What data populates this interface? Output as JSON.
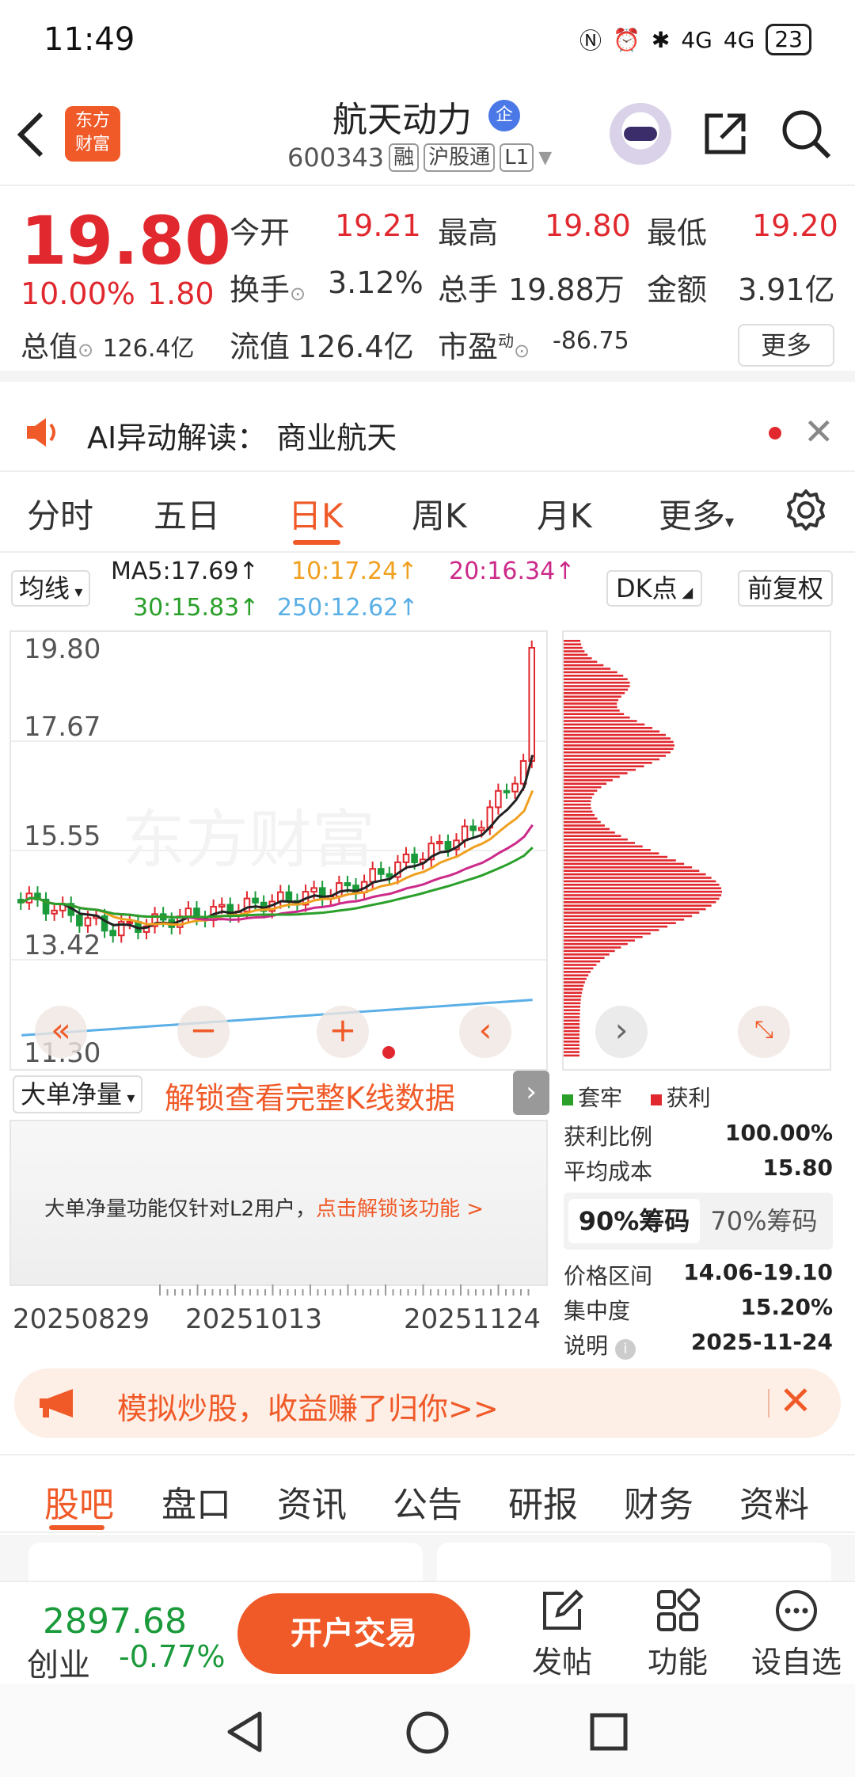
{
  "status": {
    "time": "11:49",
    "battery": "23",
    "net1": "4G",
    "net2": "4G"
  },
  "header": {
    "stock_name": "航天动力",
    "badge": "企",
    "code": "600343",
    "tags": [
      "融",
      "沪股通",
      "L1"
    ],
    "logo_line1": "东方",
    "logo_line2": "财富"
  },
  "quote": {
    "price": "19.80",
    "pct": "10.00%",
    "change": "1.80",
    "total_value_label": "总值",
    "total_value": "126.4亿",
    "open_label": "今开",
    "open": "19.21",
    "high_label": "最高",
    "high": "19.80",
    "low_label": "最低",
    "low": "19.20",
    "turnover_label": "换手",
    "turnover": "3.12%",
    "volume_label": "总手",
    "volume": "19.88万",
    "amount_label": "金额",
    "amount": "3.91亿",
    "float_label": "流值",
    "float": "126.4亿",
    "pe_label": "市盈",
    "pe_sup": "动",
    "pe": "-86.75",
    "more": "更多"
  },
  "ai_bar": {
    "text": "AI异动解读：  商业航天"
  },
  "tabs": [
    "分时",
    "五日",
    "日K",
    "周K",
    "月K",
    "更多"
  ],
  "active_tab": "日K",
  "ma": {
    "select": "均线",
    "ma5": "MA5:17.69↑",
    "ma10": "10:17.24↑",
    "ma20": "20:16.34↑",
    "ma30": "30:15.83↑",
    "ma250": "250:12.62↑",
    "dk": "DK点",
    "fq": "前复权",
    "colors": {
      "ma5": "#222222",
      "ma10": "#f0a020",
      "ma20": "#cc2a8a",
      "ma30": "#2aa02a",
      "ma250": "#5aafe6"
    }
  },
  "chart_data": {
    "type": "candlestick",
    "y_ticks": [
      "19.80",
      "17.67",
      "15.55",
      "13.42",
      "11.30"
    ],
    "ylim": [
      11.3,
      19.8
    ],
    "x_ticks": [
      "20250829",
      "20251013",
      "20251124"
    ],
    "last_close": 19.8,
    "series": [
      {
        "name": "MA5",
        "value": 17.69
      },
      {
        "name": "10",
        "value": 17.24
      },
      {
        "name": "20",
        "value": 16.34
      },
      {
        "name": "30",
        "value": 15.83
      },
      {
        "name": "250",
        "value": 12.62
      }
    ]
  },
  "lower": {
    "select": "大单净量",
    "unlock_k": "解锁查看完整K线数据",
    "l2_text": "大单净量功能仅针对L2用户，",
    "l2_link": "点击解锁该功能 >"
  },
  "chips": {
    "legend_trapped": "套牢",
    "legend_profit": "获利",
    "profit_ratio_label": "获利比例",
    "profit_ratio": "100.00%",
    "avg_cost_label": "平均成本",
    "avg_cost": "15.80",
    "tab_90": "90%筹码",
    "tab_70": "70%筹码",
    "range_label": "价格区间",
    "range": "14.06-19.10",
    "conc_label": "集中度",
    "conc": "15.20%",
    "note_label": "说明",
    "note": "2025-11-24"
  },
  "banner": {
    "text": "模拟炒股，收益赚了归你>>"
  },
  "sub_tabs": [
    "股吧",
    "盘口",
    "资讯",
    "公告",
    "研报",
    "财务",
    "资料"
  ],
  "bottom": {
    "index_value": "2897.68",
    "index_name": "创业",
    "index_pct": "-0.77%",
    "trade": "开户交易",
    "post": "发帖",
    "func": "功能",
    "watch": "设自选"
  }
}
